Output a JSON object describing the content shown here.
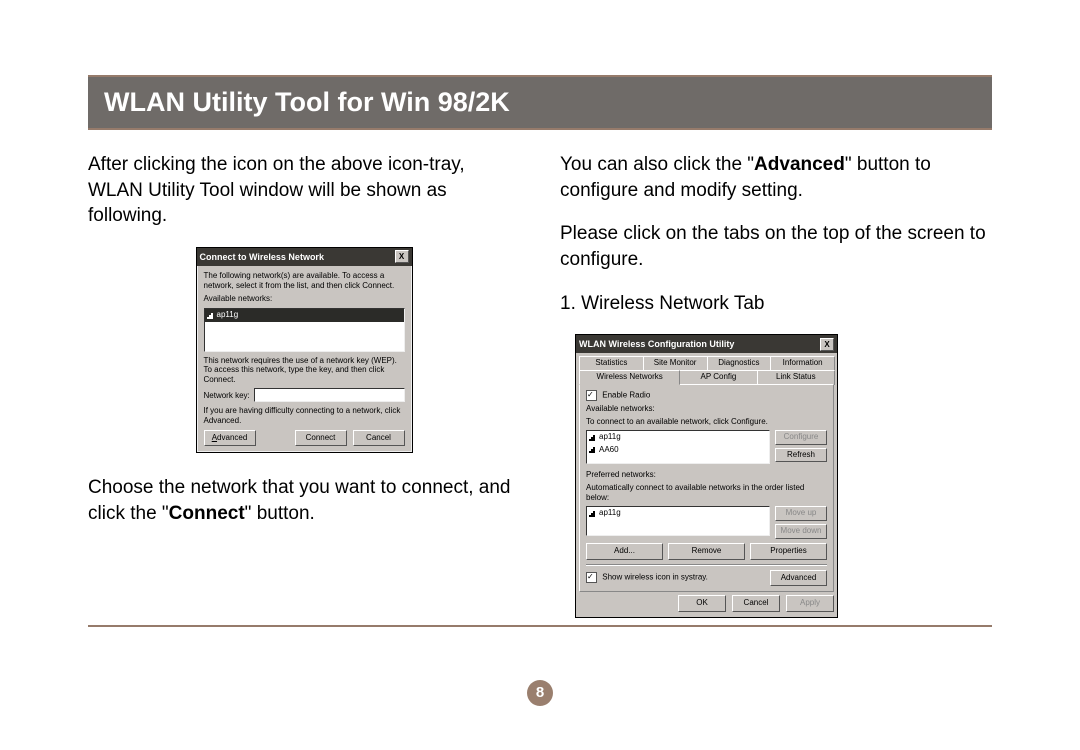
{
  "header": {
    "title": "WLAN Utility Tool for Win 98/2K"
  },
  "left": {
    "p1": "After clicking the icon on the above icon-tray, WLAN Utility Tool window will be shown as following.",
    "p2_a": "Choose the network that you want to connect, and click the \"",
    "p2_bold": "Connect",
    "p2_b": "\" button."
  },
  "right": {
    "p1_a": "You can also click the \"",
    "p1_bold": "Advanced",
    "p1_b": "\" button to configure and modify setting.",
    "p2": "Please click on the tabs on the top of the screen to configure.",
    "p3": "1. Wireless Network Tab"
  },
  "dlg1": {
    "title": "Connect to Wireless Network",
    "close": "X",
    "instr": "The following network(s) are available. To access a network, select it from the list, and then click Connect.",
    "avail_label": "Available networks:",
    "selected_ssid": "ap11g",
    "wep_text": "This network requires the use of a network key (WEP). To access this network, type the key, and then click Connect.",
    "key_label": "Network key:",
    "adv_text": "If you are having difficulty connecting to a network, click Advanced.",
    "btn_advanced": "Advanced",
    "btn_connect": "Connect",
    "btn_cancel": "Cancel"
  },
  "dlg2": {
    "title": "WLAN Wireless Configuration Utility",
    "close": "X",
    "tabs_row1": [
      "Statistics",
      "Site Monitor",
      "Diagnostics",
      "Information"
    ],
    "tabs_row2": [
      "Wireless Networks",
      "AP Config",
      "Link Status"
    ],
    "enable_radio": "Enable Radio",
    "avail_label": "Available networks:",
    "avail_help": "To connect to an available network, click Configure.",
    "avail_items": [
      "ap11g",
      "AA60"
    ],
    "btn_configure": "Configure",
    "btn_refresh": "Refresh",
    "pref_label": "Preferred networks:",
    "pref_help": "Automatically connect to available networks in the order listed below:",
    "pref_items": [
      "ap11g"
    ],
    "btn_moveup": "Move up",
    "btn_movedown": "Move down",
    "btn_add": "Add...",
    "btn_remove": "Remove",
    "btn_properties": "Properties",
    "show_icon": "Show wireless icon in systray.",
    "btn_advanced": "Advanced",
    "btn_ok": "OK",
    "btn_cancel": "Cancel",
    "btn_apply": "Apply"
  },
  "page_number": "8"
}
